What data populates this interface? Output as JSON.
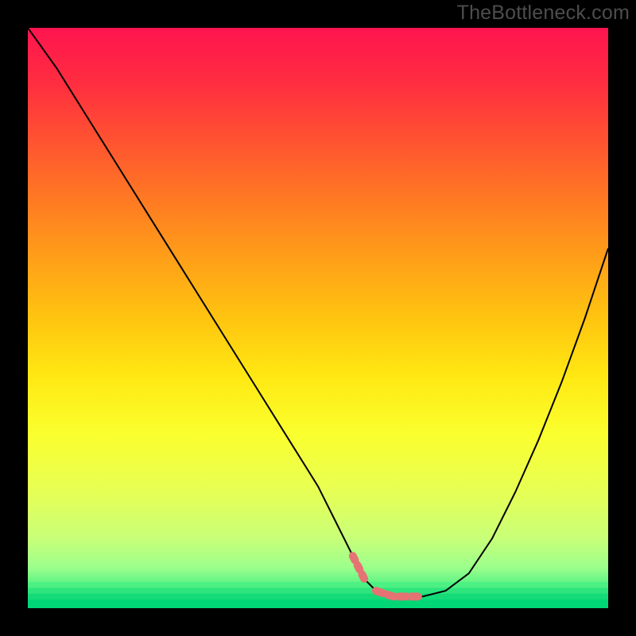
{
  "watermark": "TheBottleneck.com",
  "chart_data": {
    "type": "line",
    "title": "",
    "xlabel": "",
    "ylabel": "",
    "xlim": [
      0,
      100
    ],
    "ylim": [
      0,
      100
    ],
    "series": [
      {
        "name": "bottleneck-curve",
        "x": [
          0,
          5,
          10,
          15,
          20,
          25,
          30,
          35,
          40,
          45,
          50,
          53,
          56,
          58,
          60,
          63,
          65,
          68,
          72,
          76,
          80,
          84,
          88,
          92,
          96,
          100
        ],
        "y": [
          100,
          93,
          85,
          77,
          69,
          61,
          53,
          45,
          37,
          29,
          21,
          15,
          9,
          5,
          3,
          2,
          2,
          2,
          3,
          6,
          12,
          20,
          29,
          39,
          50,
          62
        ]
      }
    ],
    "highlights": [
      {
        "name": "left-marker-cluster",
        "x_range": [
          56,
          59
        ],
        "y_range": [
          4,
          9
        ]
      },
      {
        "name": "bottom-marker-cluster",
        "x_range": [
          59,
          70
        ],
        "y_range": [
          2,
          3
        ]
      },
      {
        "name": "right-marker-cluster",
        "x_range": [
          70,
          73
        ],
        "y_range": [
          3,
          6
        ]
      }
    ],
    "gradient_stops": [
      {
        "offset": 0.0,
        "color": "#ff1450"
      },
      {
        "offset": 0.1,
        "color": "#ff2f3f"
      },
      {
        "offset": 0.2,
        "color": "#ff5530"
      },
      {
        "offset": 0.3,
        "color": "#ff7b22"
      },
      {
        "offset": 0.4,
        "color": "#ffa018"
      },
      {
        "offset": 0.5,
        "color": "#ffc410"
      },
      {
        "offset": 0.6,
        "color": "#ffe812"
      },
      {
        "offset": 0.7,
        "color": "#faff2e"
      },
      {
        "offset": 0.8,
        "color": "#e6ff55"
      },
      {
        "offset": 0.88,
        "color": "#c8ff78"
      },
      {
        "offset": 0.93,
        "color": "#9cff8c"
      },
      {
        "offset": 0.965,
        "color": "#4df083"
      },
      {
        "offset": 1.0,
        "color": "#00d676"
      }
    ],
    "bottom_bands": [
      {
        "y": 0.965,
        "color": "#4df083"
      },
      {
        "y": 0.975,
        "color": "#2de57c"
      },
      {
        "y": 0.985,
        "color": "#14da78"
      },
      {
        "y": 1.0,
        "color": "#00d676"
      }
    ],
    "marker_color": "#e57373"
  }
}
